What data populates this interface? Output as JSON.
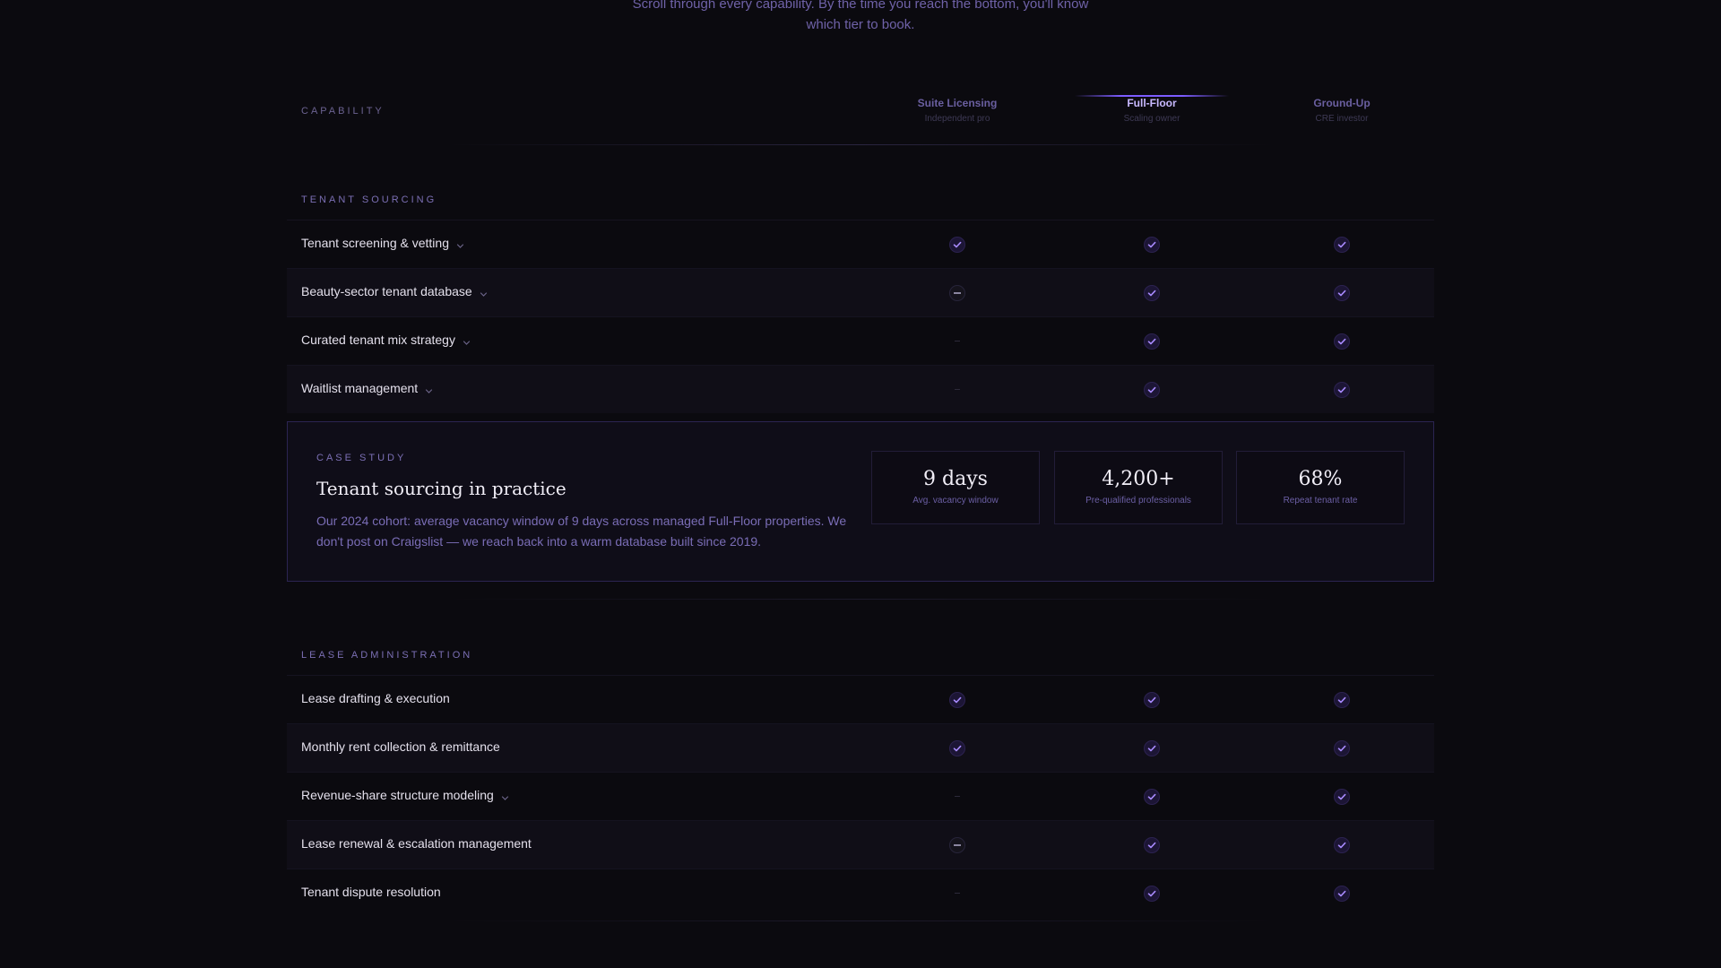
{
  "intro": {
    "line1": "Scroll through every capability. By the time you reach the bottom, you'll know",
    "line2": "which tier to book."
  },
  "table_header": {
    "capability_label": "CAPABILITY",
    "tiers": [
      {
        "name": "Suite Licensing",
        "subtitle": "Independent pro"
      },
      {
        "name": "Full-Floor",
        "subtitle": "Scaling owner",
        "featured": true
      },
      {
        "name": "Ground-Up",
        "subtitle": "CRE investor"
      }
    ]
  },
  "sections": [
    {
      "title": "TENANT SOURCING",
      "rows": [
        {
          "label": "Tenant screening & vetting",
          "expandable": true,
          "values": [
            "check",
            "check",
            "check"
          ]
        },
        {
          "label": "Beauty-sector tenant database",
          "expandable": true,
          "values": [
            "dash",
            "check",
            "check"
          ]
        },
        {
          "label": "Curated tenant mix strategy",
          "expandable": true,
          "values": [
            "none",
            "check",
            "check"
          ]
        },
        {
          "label": "Waitlist management",
          "expandable": true,
          "values": [
            "none",
            "check",
            "check"
          ]
        }
      ]
    },
    {
      "title": "LEASE ADMINISTRATION",
      "rows": [
        {
          "label": "Lease drafting & execution",
          "expandable": false,
          "values": [
            "check",
            "check",
            "check"
          ]
        },
        {
          "label": "Monthly rent collection & remittance",
          "expandable": false,
          "values": [
            "check",
            "check",
            "check"
          ]
        },
        {
          "label": "Revenue-share structure modeling",
          "expandable": true,
          "values": [
            "none",
            "check",
            "check"
          ]
        },
        {
          "label": "Lease renewal & escalation management",
          "expandable": false,
          "values": [
            "dash",
            "check",
            "check"
          ]
        },
        {
          "label": "Tenant dispute resolution",
          "expandable": false,
          "values": [
            "none",
            "check",
            "check"
          ]
        }
      ]
    }
  ],
  "case_study": {
    "eyebrow": "CASE STUDY",
    "title": "Tenant sourcing in practice",
    "body": "Our 2024 cohort: average vacancy window of 9 days across managed Full-Floor properties. We don't post on Craigslist — we reach back into a warm database built since 2019.",
    "stats": [
      {
        "value": "9 days",
        "label": "Avg. vacancy window"
      },
      {
        "value": "4,200+",
        "label": "Pre-qualified professionals"
      },
      {
        "value": "68%",
        "label": "Repeat tenant rate"
      }
    ]
  },
  "colors": {
    "accent": "#7c5cff",
    "background": "#0b0a0f",
    "muted_text": "#7a6db6"
  },
  "icons": {
    "check": "check-icon",
    "dash": "dash-icon",
    "chevron": "chevron-down-icon"
  }
}
